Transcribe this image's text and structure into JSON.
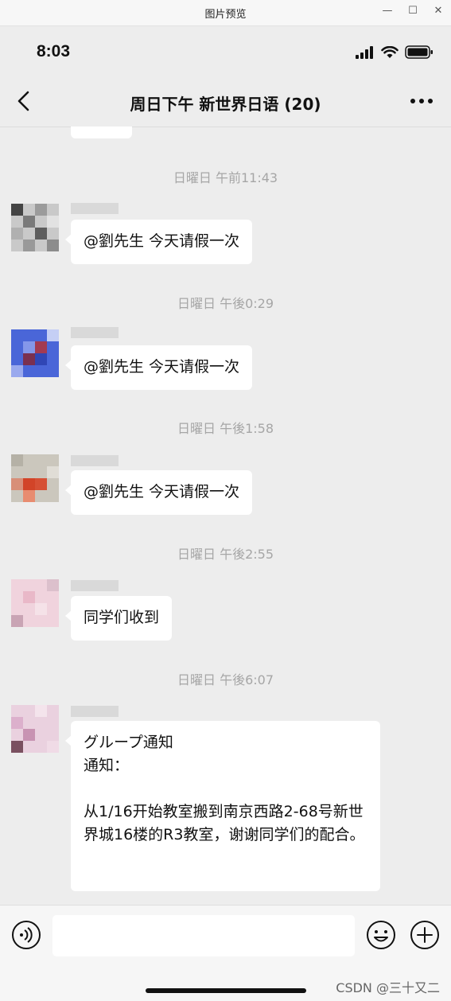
{
  "window": {
    "title": "图片预览",
    "min_glyph": "—",
    "max_glyph": "☐",
    "close_glyph": "✕"
  },
  "status_bar": {
    "time": "8:03"
  },
  "nav": {
    "title": "周日下午 新世界日语 (20)"
  },
  "messages": [
    {
      "timestamp": "日曜日 午前11:43",
      "text": "@劉先生 今天请假一次",
      "avatar_color": "#8c8c8c"
    },
    {
      "timestamp": "日曜日 午後0:29",
      "text": "@劉先生 今天请假一次",
      "avatar_color": "#4a66d8"
    },
    {
      "timestamp": "日曜日 午後1:58",
      "text": "@劉先生 今天请假一次",
      "avatar_color": "#d65035"
    },
    {
      "timestamp": "日曜日 午後2:55",
      "text": "同学们收到",
      "avatar_color": "#e9b8c8"
    },
    {
      "timestamp": "日曜日 午後6:07",
      "text": "グループ通知\n通知：\n\n从1/16开始教室搬到南京西路2-68号新世界城16楼的R3教室，谢谢同学们的配合。",
      "avatar_color": "#dcb0cc"
    }
  ],
  "input_bar": {
    "voice_icon": "voice-icon",
    "emoji_icon": "emoji-icon",
    "plus_icon": "plus-icon"
  },
  "watermark": "CSDN @三十又二"
}
